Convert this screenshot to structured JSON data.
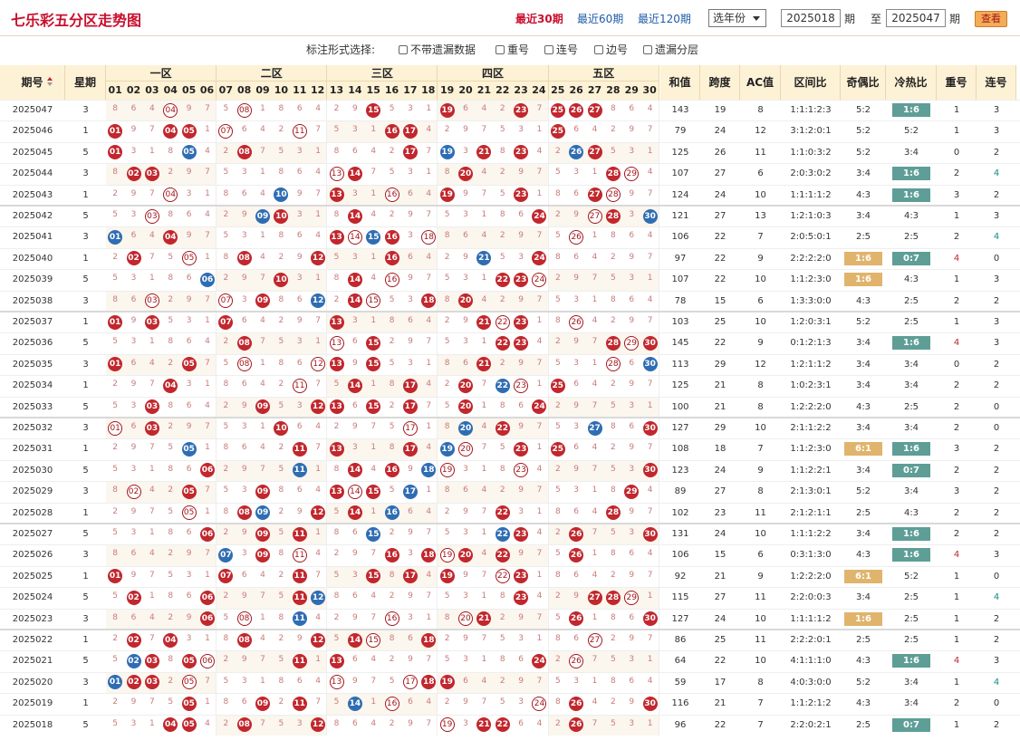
{
  "header": {
    "title": "七乐彩五分区走势图",
    "nav": [
      "最近30期",
      "最近60期",
      "最近120期"
    ],
    "nav_active": 0,
    "year_select": "选年份",
    "from": "2025018",
    "from_label": "期",
    "to_label": "至",
    "to": "2025047",
    "to_suffix": "期",
    "query_button": "查看"
  },
  "options": {
    "label": "标注形式选择:",
    "items": [
      "不带遗漏数据",
      "重号",
      "连号",
      "边号",
      "遗漏分层"
    ]
  },
  "columns": {
    "issue": "期号",
    "weekday": "星期",
    "zones": [
      "一区",
      "二区",
      "三区",
      "四区",
      "五区"
    ],
    "stats": [
      "和值",
      "跨度",
      "AC值",
      "区间比",
      "奇偶比",
      "冷热比",
      "重号",
      "连号"
    ]
  },
  "rows": [
    {
      "issue": "2025047",
      "wd": "3",
      "nums": [
        4,
        8,
        15,
        19,
        23,
        25,
        26,
        27
      ],
      "sum": "143",
      "span": "19",
      "ac": "8",
      "zone": "1:1:1:2:3",
      "oe": "5:2",
      "hc": "1:6",
      "rep": "1",
      "con": "3"
    },
    {
      "issue": "2025046",
      "wd": "1",
      "nums": [
        1,
        4,
        5,
        7,
        11,
        16,
        17,
        25
      ],
      "sum": "79",
      "span": "24",
      "ac": "12",
      "zone": "3:1:2:0:1",
      "oe": "5:2",
      "hc": "5:2",
      "rep": "1",
      "con": "3"
    },
    {
      "issue": "2025045",
      "wd": "5",
      "nums": [
        1,
        5,
        8,
        17,
        19,
        21,
        23,
        26,
        27
      ],
      "sum": "125",
      "span": "26",
      "ac": "11",
      "zone": "1:1:0:3:2",
      "oe": "5:2",
      "hc": "3:4",
      "rep": "0",
      "con": "2"
    },
    {
      "issue": "2025044",
      "wd": "3",
      "nums": [
        2,
        3,
        13,
        14,
        20,
        28,
        29
      ],
      "sum": "107",
      "span": "27",
      "ac": "6",
      "zone": "2:0:3:0:2",
      "oe": "3:4",
      "hc": "1:6",
      "rep": "2",
      "con": "4"
    },
    {
      "issue": "2025043",
      "wd": "1",
      "nums": [
        4,
        10,
        13,
        16,
        19,
        23,
        27,
        28
      ],
      "sum": "124",
      "span": "24",
      "ac": "10",
      "zone": "1:1:1:1:2",
      "oe": "4:3",
      "hc": "1:6",
      "rep": "3",
      "con": "2"
    },
    {
      "issue": "2025042",
      "wd": "5",
      "nums": [
        3,
        9,
        10,
        14,
        24,
        27,
        28,
        30
      ],
      "sum": "121",
      "span": "27",
      "ac": "13",
      "zone": "1:2:1:0:3",
      "oe": "3:4",
      "hc": "4:3",
      "rep": "1",
      "con": "3"
    },
    {
      "issue": "2025041",
      "wd": "3",
      "nums": [
        1,
        4,
        13,
        14,
        15,
        16,
        18,
        26
      ],
      "sum": "106",
      "span": "22",
      "ac": "7",
      "zone": "2:0:5:0:1",
      "oe": "2:5",
      "hc": "2:5",
      "rep": "2",
      "con": "4"
    },
    {
      "issue": "2025040",
      "wd": "1",
      "nums": [
        2,
        5,
        8,
        12,
        16,
        21,
        24
      ],
      "sum": "97",
      "span": "22",
      "ac": "9",
      "zone": "2:2:2:2:0",
      "oe": "1:6",
      "hc": "0:7",
      "rep": "4",
      "con": "0"
    },
    {
      "issue": "2025039",
      "wd": "5",
      "nums": [
        6,
        10,
        14,
        16,
        22,
        23,
        24
      ],
      "sum": "107",
      "span": "22",
      "ac": "10",
      "zone": "1:1:2:3:0",
      "oe": "1:6",
      "hc": "4:3",
      "rep": "1",
      "con": "3"
    },
    {
      "issue": "2025038",
      "wd": "3",
      "nums": [
        3,
        7,
        9,
        12,
        14,
        15,
        18,
        20
      ],
      "sum": "78",
      "span": "15",
      "ac": "6",
      "zone": "1:3:3:0:0",
      "oe": "4:3",
      "hc": "2:5",
      "rep": "2",
      "con": "2"
    },
    {
      "issue": "2025037",
      "wd": "1",
      "nums": [
        1,
        3,
        7,
        13,
        21,
        22,
        23,
        26
      ],
      "sum": "103",
      "span": "25",
      "ac": "10",
      "zone": "1:2:0:3:1",
      "oe": "5:2",
      "hc": "2:5",
      "rep": "1",
      "con": "3"
    },
    {
      "issue": "2025036",
      "wd": "5",
      "nums": [
        8,
        13,
        15,
        22,
        23,
        28,
        29,
        30
      ],
      "sum": "145",
      "span": "22",
      "ac": "9",
      "zone": "0:1:2:1:3",
      "oe": "3:4",
      "hc": "1:6",
      "rep": "4",
      "con": "3"
    },
    {
      "issue": "2025035",
      "wd": "3",
      "nums": [
        1,
        5,
        8,
        12,
        13,
        15,
        21,
        28,
        30
      ],
      "sum": "113",
      "span": "29",
      "ac": "12",
      "zone": "1:2:1:1:2",
      "oe": "3:4",
      "hc": "3:4",
      "rep": "0",
      "con": "2"
    },
    {
      "issue": "2025034",
      "wd": "1",
      "nums": [
        4,
        11,
        14,
        17,
        20,
        22,
        23,
        25
      ],
      "sum": "125",
      "span": "21",
      "ac": "8",
      "zone": "1:0:2:3:1",
      "oe": "3:4",
      "hc": "3:4",
      "rep": "2",
      "con": "2"
    },
    {
      "issue": "2025033",
      "wd": "5",
      "nums": [
        3,
        9,
        12,
        13,
        15,
        17,
        20,
        24
      ],
      "sum": "100",
      "span": "21",
      "ac": "8",
      "zone": "1:2:2:2:0",
      "oe": "4:3",
      "hc": "2:5",
      "rep": "2",
      "con": "0"
    },
    {
      "issue": "2025032",
      "wd": "3",
      "nums": [
        1,
        3,
        10,
        17,
        20,
        22,
        27,
        30
      ],
      "sum": "127",
      "span": "29",
      "ac": "10",
      "zone": "2:1:1:2:2",
      "oe": "3:4",
      "hc": "3:4",
      "rep": "2",
      "con": "0"
    },
    {
      "issue": "2025031",
      "wd": "1",
      "nums": [
        5,
        11,
        13,
        17,
        19,
        20,
        23,
        25
      ],
      "sum": "108",
      "span": "18",
      "ac": "7",
      "zone": "1:1:2:3:0",
      "oe": "6:1",
      "hc": "1:6",
      "rep": "3",
      "con": "2"
    },
    {
      "issue": "2025030",
      "wd": "5",
      "nums": [
        6,
        11,
        14,
        16,
        18,
        19,
        23,
        30
      ],
      "sum": "123",
      "span": "24",
      "ac": "9",
      "zone": "1:1:2:2:1",
      "oe": "3:4",
      "hc": "0:7",
      "rep": "2",
      "con": "2"
    },
    {
      "issue": "2025029",
      "wd": "3",
      "nums": [
        2,
        5,
        9,
        13,
        14,
        15,
        17,
        29
      ],
      "sum": "89",
      "span": "27",
      "ac": "8",
      "zone": "2:1:3:0:1",
      "oe": "5:2",
      "hc": "3:4",
      "rep": "3",
      "con": "2"
    },
    {
      "issue": "2025028",
      "wd": "1",
      "nums": [
        5,
        8,
        9,
        12,
        14,
        16,
        22,
        28
      ],
      "sum": "102",
      "span": "23",
      "ac": "11",
      "zone": "2:1:2:1:1",
      "oe": "2:5",
      "hc": "4:3",
      "rep": "2",
      "con": "2"
    },
    {
      "issue": "2025027",
      "wd": "5",
      "nums": [
        6,
        9,
        11,
        15,
        22,
        23,
        26,
        30
      ],
      "sum": "131",
      "span": "24",
      "ac": "10",
      "zone": "1:1:1:2:2",
      "oe": "3:4",
      "hc": "1:6",
      "rep": "2",
      "con": "2"
    },
    {
      "issue": "2025026",
      "wd": "3",
      "nums": [
        7,
        9,
        11,
        16,
        18,
        19,
        20,
        22,
        26
      ],
      "sum": "106",
      "span": "15",
      "ac": "6",
      "zone": "0:3:1:3:0",
      "oe": "4:3",
      "hc": "1:6",
      "rep": "4",
      "con": "3"
    },
    {
      "issue": "2025025",
      "wd": "1",
      "nums": [
        1,
        7,
        11,
        15,
        17,
        19,
        22,
        23
      ],
      "sum": "92",
      "span": "21",
      "ac": "9",
      "zone": "1:2:2:2:0",
      "oe": "6:1",
      "hc": "5:2",
      "rep": "1",
      "con": "0"
    },
    {
      "issue": "2025024",
      "wd": "5",
      "nums": [
        2,
        6,
        11,
        12,
        23,
        27,
        28,
        29
      ],
      "sum": "115",
      "span": "27",
      "ac": "11",
      "zone": "2:2:0:0:3",
      "oe": "3:4",
      "hc": "2:5",
      "rep": "1",
      "con": "4"
    },
    {
      "issue": "2025023",
      "wd": "3",
      "nums": [
        6,
        8,
        11,
        16,
        20,
        21,
        26,
        30
      ],
      "sum": "127",
      "span": "24",
      "ac": "10",
      "zone": "1:1:1:1:2",
      "oe": "1:6",
      "hc": "2:5",
      "rep": "1",
      "con": "2"
    },
    {
      "issue": "2025022",
      "wd": "1",
      "nums": [
        2,
        4,
        8,
        12,
        14,
        15,
        18,
        27
      ],
      "sum": "86",
      "span": "25",
      "ac": "11",
      "zone": "2:2:2:0:1",
      "oe": "2:5",
      "hc": "2:5",
      "rep": "1",
      "con": "2"
    },
    {
      "issue": "2025021",
      "wd": "5",
      "nums": [
        2,
        3,
        5,
        6,
        11,
        13,
        24,
        26
      ],
      "sum": "64",
      "span": "22",
      "ac": "10",
      "zone": "4:1:1:1:0",
      "oe": "4:3",
      "hc": "1:6",
      "rep": "4",
      "con": "3"
    },
    {
      "issue": "2025020",
      "wd": "3",
      "nums": [
        1,
        2,
        3,
        5,
        13,
        17,
        18,
        19
      ],
      "sum": "59",
      "span": "17",
      "ac": "8",
      "zone": "4:0:3:0:0",
      "oe": "5:2",
      "hc": "3:4",
      "rep": "1",
      "con": "4"
    },
    {
      "issue": "2025019",
      "wd": "1",
      "nums": [
        5,
        9,
        11,
        14,
        16,
        24,
        26,
        30
      ],
      "sum": "116",
      "span": "21",
      "ac": "7",
      "zone": "1:1:2:1:2",
      "oe": "4:3",
      "hc": "3:4",
      "rep": "2",
      "con": "0"
    },
    {
      "issue": "2025018",
      "wd": "5",
      "nums": [
        4,
        5,
        8,
        12,
        19,
        21,
        22,
        26
      ],
      "sum": "96",
      "span": "22",
      "ac": "7",
      "zone": "2:2:0:2:1",
      "oe": "2:5",
      "hc": "0:7",
      "rep": "1",
      "con": "2"
    }
  ],
  "colors": {
    "red": "#c1272d",
    "blue": "#2f6db3",
    "ring": "#a3171c",
    "tan": "#e0b46c",
    "teal": "#5e9e97"
  }
}
